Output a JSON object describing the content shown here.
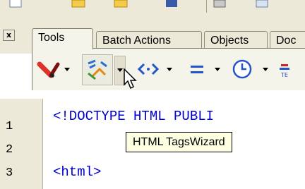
{
  "tabs": [
    {
      "label": "Tools",
      "active": true
    },
    {
      "label": "Batch Actions",
      "active": false
    },
    {
      "label": "Objects",
      "active": false
    },
    {
      "label": "Doc",
      "active": false
    }
  ],
  "panel": {
    "close_glyph": "x"
  },
  "tools": [
    {
      "name": "paint-brush-icon"
    },
    {
      "name": "tags-wizard-icon"
    },
    {
      "name": "angle-brackets-icon",
      "glyph": "<·>"
    },
    {
      "name": "equals-icon",
      "glyph": "="
    },
    {
      "name": "clock-icon"
    },
    {
      "name": "table-icon",
      "glyph": "T"
    }
  ],
  "editor": {
    "line_numbers": [
      "1",
      "2",
      "3"
    ],
    "lines": [
      "<!DOCTYPE HTML PUBLI",
      "",
      "<html>"
    ]
  },
  "tooltip": {
    "text": "HTML TagsWizard"
  },
  "colors": {
    "chrome": "#ece9d8",
    "code_blue": "#0000cc",
    "tooltip_bg": "#ffffe1"
  }
}
